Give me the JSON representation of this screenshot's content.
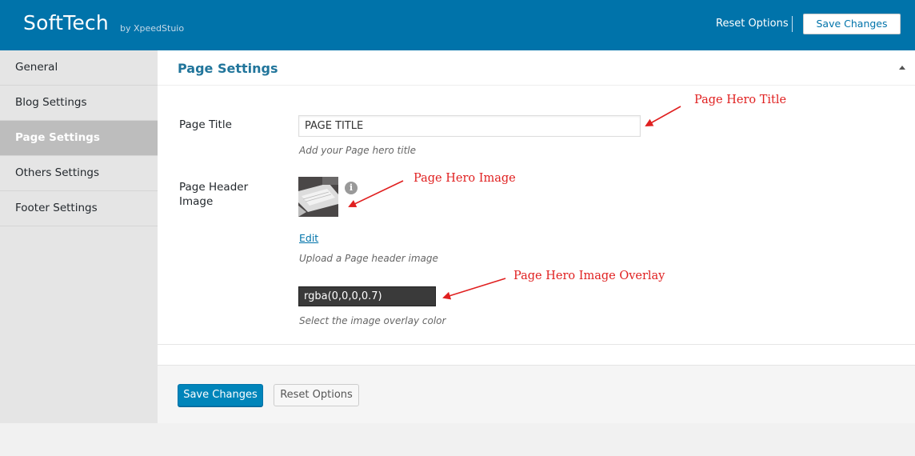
{
  "header": {
    "brand": "SoftTech",
    "by_line": "by XpeedStuio",
    "reset_label": "Reset Options",
    "save_label": "Save Changes"
  },
  "sidebar": {
    "items": [
      {
        "label": "General",
        "active": false
      },
      {
        "label": "Blog Settings",
        "active": false
      },
      {
        "label": "Page Settings",
        "active": true
      },
      {
        "label": "Others Settings",
        "active": false
      },
      {
        "label": "Footer Settings",
        "active": false
      }
    ]
  },
  "main": {
    "title": "Page Settings",
    "page_title": {
      "label": "Page Title",
      "value": "PAGE TITLE",
      "description": "Add your Page hero title"
    },
    "header_image": {
      "label": "Page Header Image",
      "info_glyph": "i",
      "edit_label": "Edit",
      "description": "Upload a Page header image"
    },
    "overlay": {
      "value": "rgba(0,0,0,0.7)",
      "description": "Select the image overlay color"
    },
    "footer": {
      "save_label": "Save Changes",
      "reset_label": "Reset Options"
    }
  },
  "annotations": {
    "hero_title": "Page Hero Title",
    "hero_image": "Page Hero Image",
    "hero_overlay": "Page Hero Image Overlay"
  },
  "colors": {
    "header_bg": "#0073aa",
    "accent": "#21759b",
    "primary_button": "#0085ba",
    "annotation": "#e02020"
  }
}
